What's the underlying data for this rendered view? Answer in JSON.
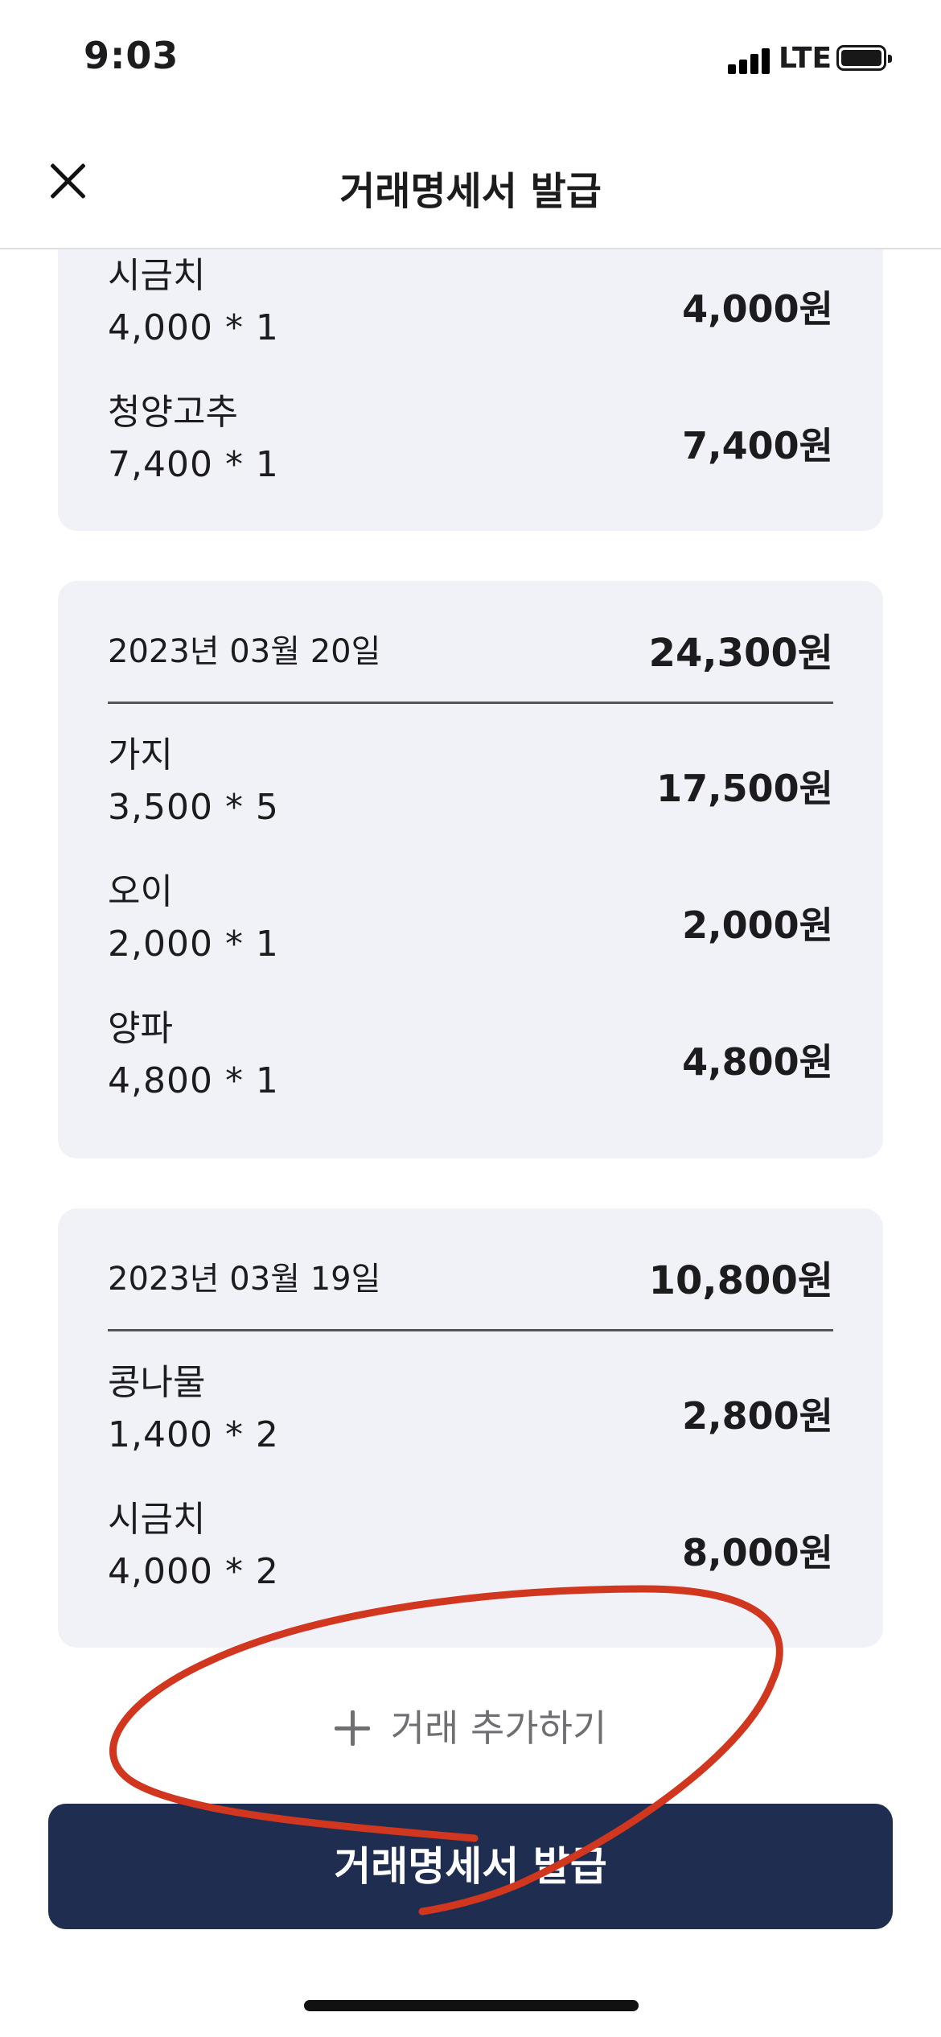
{
  "status_bar": {
    "time": "9:03",
    "network": "LTE"
  },
  "header": {
    "title": "거래명세서 발급"
  },
  "partial_card": {
    "items": [
      {
        "name": "시금치",
        "qty": "4,000 * 1",
        "amount": "4,000원"
      },
      {
        "name": "청양고추",
        "qty": "7,400 * 1",
        "amount": "7,400원"
      }
    ]
  },
  "cards": [
    {
      "date": "2023년 03월 20일",
      "total": "24,300원",
      "items": [
        {
          "name": "가지",
          "qty": "3,500 * 5",
          "amount": "17,500원"
        },
        {
          "name": "오이",
          "qty": "2,000 * 1",
          "amount": "2,000원"
        },
        {
          "name": "양파",
          "qty": "4,800 * 1",
          "amount": "4,800원"
        }
      ]
    },
    {
      "date": "2023년 03월 19일",
      "total": "10,800원",
      "items": [
        {
          "name": "콩나물",
          "qty": "1,400 * 2",
          "amount": "2,800원"
        },
        {
          "name": "시금치",
          "qty": "4,000 * 2",
          "amount": "8,000원"
        }
      ]
    }
  ],
  "add_transaction": {
    "label": "거래 추가하기"
  },
  "issue_button": {
    "label": "거래명세서 발급"
  },
  "colors": {
    "primary": "#1f2d50",
    "card_bg": "#f1f2f7",
    "annotation": "#d1361f",
    "muted": "#6e6e73"
  }
}
